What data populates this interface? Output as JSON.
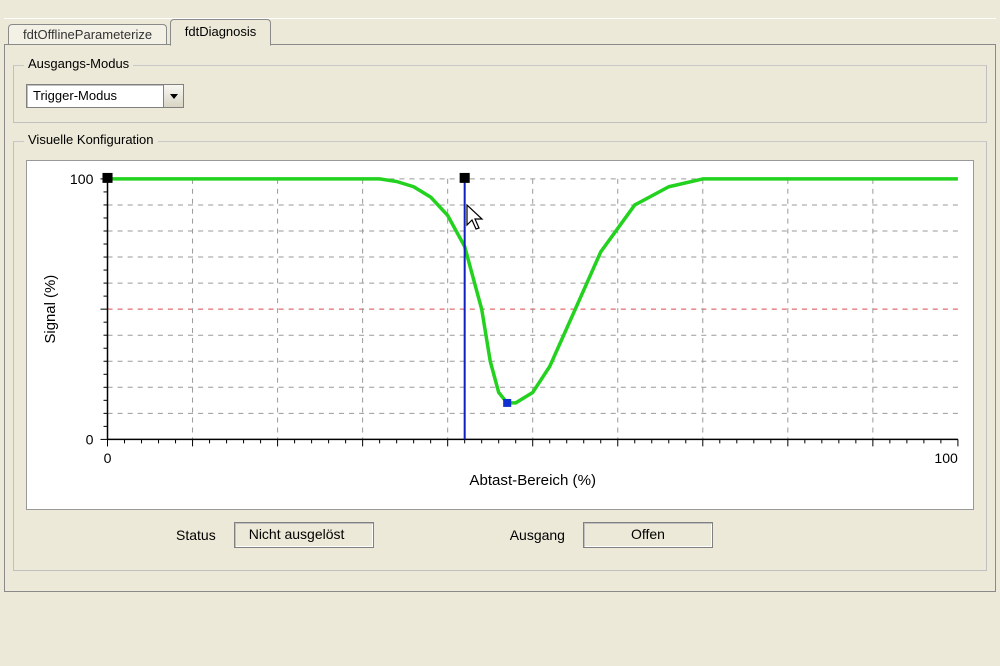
{
  "tabs": {
    "parameterize": "fdtOfflineParameterize",
    "diagnosis": "fdtDiagnosis"
  },
  "ausgangs_modus": {
    "legend": "Ausgangs-Modus",
    "selected": "Trigger-Modus"
  },
  "visuelle": {
    "legend": "Visuelle Konfiguration"
  },
  "chart_data": {
    "type": "line",
    "title": "",
    "xlabel": "Abtast-Bereich (%)",
    "ylabel": "Signal (%)",
    "xlim": [
      0,
      100
    ],
    "ylim": [
      0,
      100
    ],
    "x_ticks": [
      0,
      100
    ],
    "y_ticks": [
      0,
      100
    ],
    "threshold_y": 50,
    "cursor_x": 42,
    "series": [
      {
        "name": "signal",
        "color": "#22d21f",
        "x": [
          0,
          5,
          10,
          15,
          20,
          25,
          30,
          32,
          34,
          36,
          38,
          40,
          42,
          44,
          45,
          46,
          47,
          48,
          50,
          52,
          55,
          58,
          62,
          66,
          70,
          75,
          80,
          85,
          90,
          95,
          100
        ],
        "y": [
          100,
          100,
          100,
          100,
          100,
          100,
          100,
          100,
          99,
          97,
          93,
          86,
          74,
          50,
          30,
          18,
          14,
          14,
          18,
          28,
          50,
          72,
          90,
          97,
          100,
          100,
          100,
          100,
          100,
          100,
          100
        ]
      }
    ],
    "minimum_point": {
      "x": 47,
      "y": 14
    }
  },
  "status": {
    "status_label": "Status",
    "status_value": "Nicht ausgelöst",
    "ausgang_label": "Ausgang",
    "ausgang_value": "Offen"
  },
  "icons": {
    "chevron_down": "chevron-down-icon"
  }
}
